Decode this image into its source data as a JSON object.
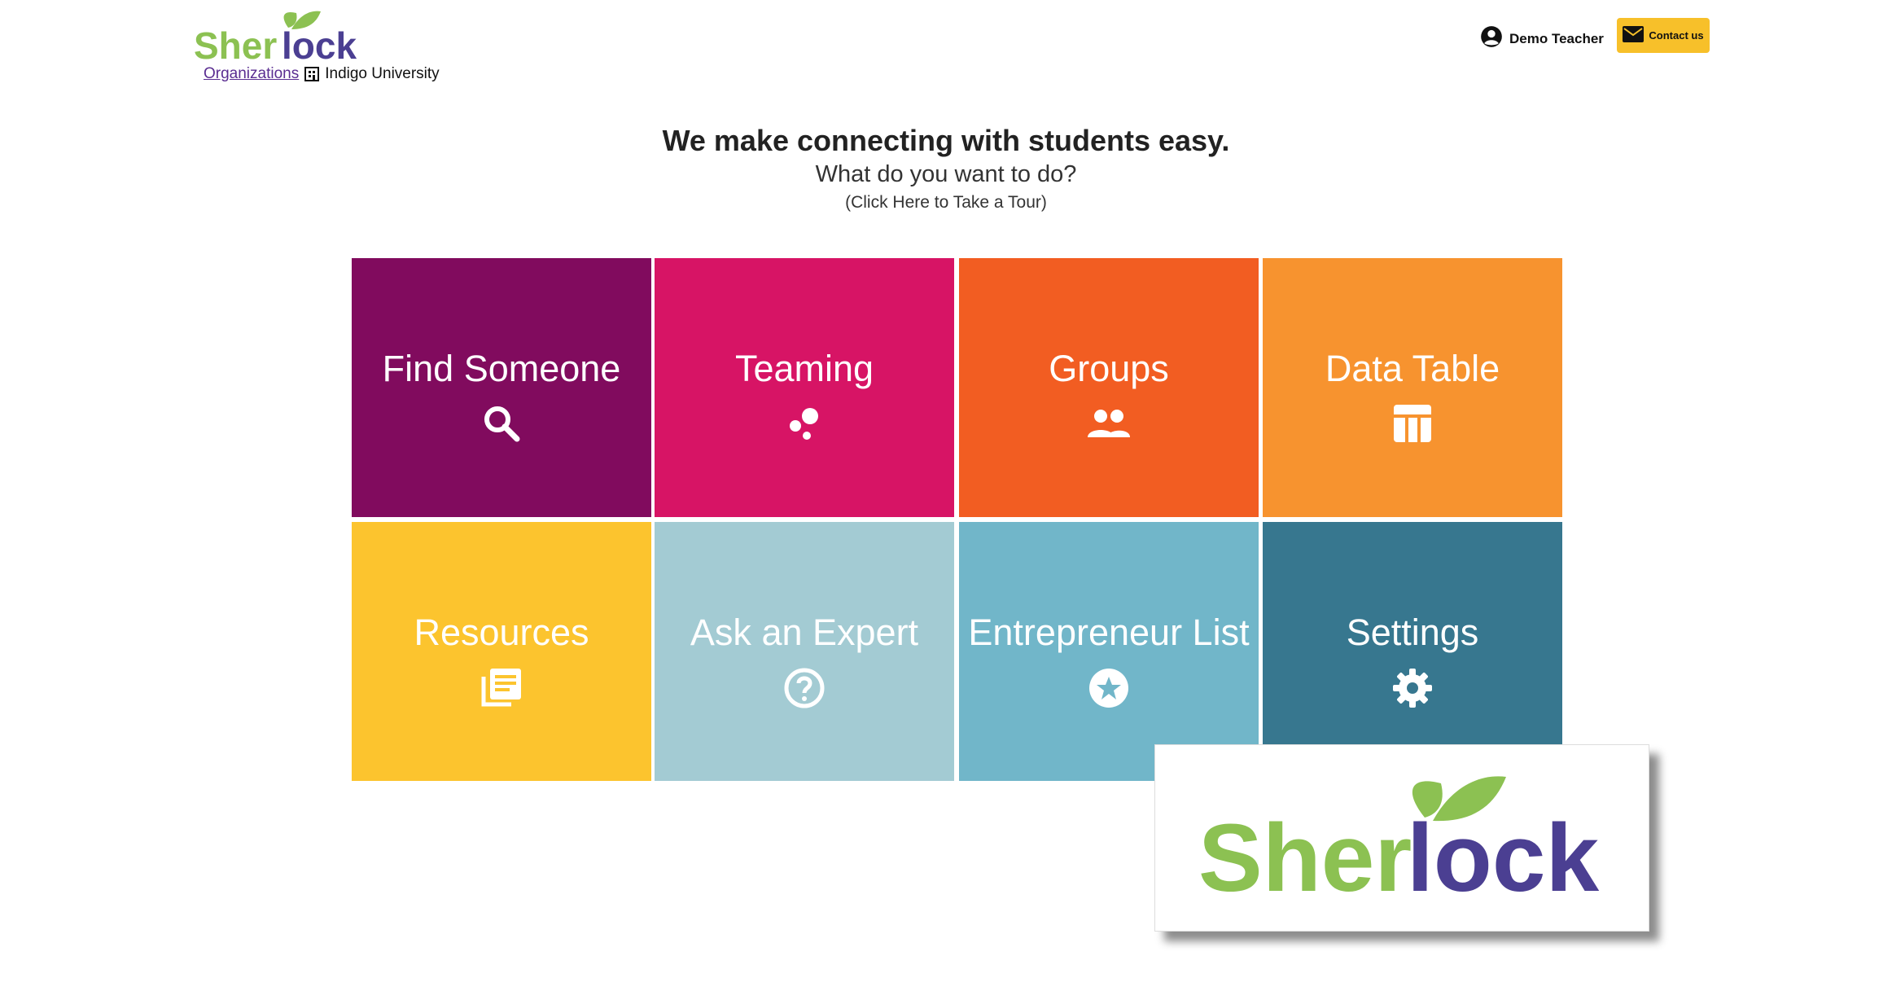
{
  "brand": {
    "name_part1": "Sher",
    "name_part2": "lock",
    "green": "#8cc152",
    "purple": "#4b3f92"
  },
  "breadcrumb": {
    "organizations_link": "Organizations",
    "org_icon": "building-icon",
    "current_org": "Indigo University"
  },
  "header": {
    "user_name": "Demo Teacher",
    "user_icon": "account-circle-icon",
    "contact_label": "Contact us",
    "contact_icon": "mail-icon"
  },
  "hero": {
    "headline": "We make connecting with students easy.",
    "subheadline": "What do you want to do?",
    "tour_link": "(Click Here to Take a Tour)"
  },
  "tiles": [
    {
      "label": "Find Someone",
      "icon": "search-icon",
      "color": "#810b5e"
    },
    {
      "label": "Teaming",
      "icon": "bubbles-icon",
      "color": "#d71465"
    },
    {
      "label": "Groups",
      "icon": "people-icon",
      "color": "#f25d22"
    },
    {
      "label": "Data Table",
      "icon": "table-icon",
      "color": "#f7932f"
    },
    {
      "label": "Resources",
      "icon": "library-books-icon",
      "color": "#fcc42e"
    },
    {
      "label": "Ask an Expert",
      "icon": "question-circle-icon",
      "color": "#a3cbd3"
    },
    {
      "label": "Entrepreneur List",
      "icon": "star-circle-icon",
      "color": "#71b6c9"
    },
    {
      "label": "Settings",
      "icon": "gear-icon",
      "color": "#37778f"
    }
  ]
}
